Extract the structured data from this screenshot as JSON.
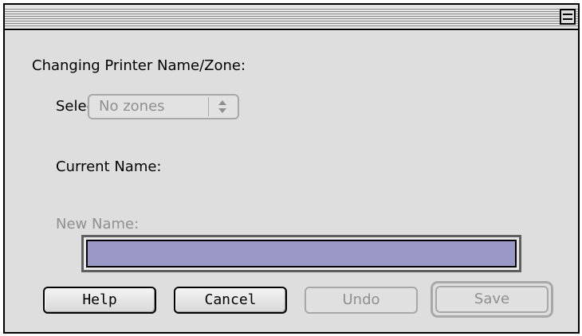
{
  "dialog": {
    "heading": "Changing Printer Name/Zone:",
    "select_zone_label": "Select Zone:",
    "zone_popup": {
      "selected": "No zones"
    },
    "current_name_label": "Current Name:",
    "current_name_value": "",
    "new_name_label": "New Name:",
    "new_name_value": ""
  },
  "buttons": {
    "help": "Help",
    "cancel": "Cancel",
    "undo": "Undo",
    "save": "Save"
  },
  "icons": {
    "zoom_box": "window-zoom-icon",
    "popup_arrows": "up-down-arrows-icon"
  },
  "colors": {
    "window_bg": "#dedede",
    "field_selection": "#9a99c6",
    "disabled_text": "#8f8f8f"
  }
}
